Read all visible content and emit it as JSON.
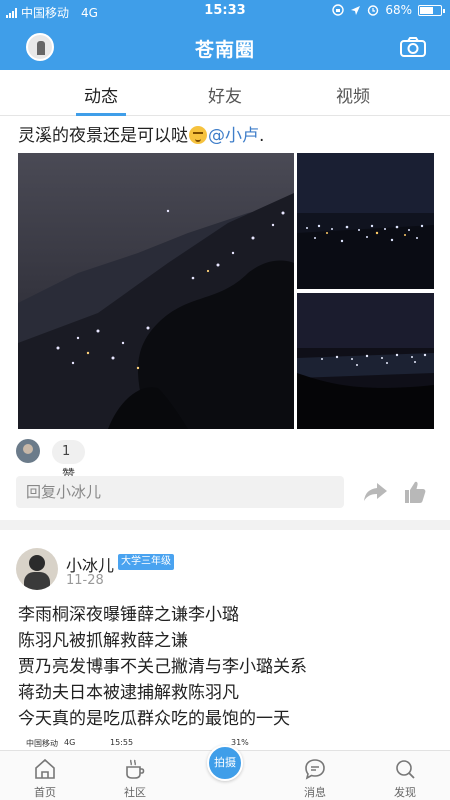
{
  "status": {
    "carrier": "中国移动",
    "network": "4G",
    "time": "15:33",
    "battery": "68%",
    "battery_fraction": 0.68,
    "icons": [
      "rotation-lock-icon",
      "location-icon",
      "alarm-icon"
    ]
  },
  "header": {
    "title": "苍南圈",
    "left_icon": "avatar",
    "right_icon": "camera-icon",
    "accent": "#3f9ee9"
  },
  "tabs": [
    {
      "label": "动态",
      "active": true
    },
    {
      "label": "好友",
      "active": false
    },
    {
      "label": "视频",
      "active": false
    }
  ],
  "post1": {
    "text": "灵溪的夜景还是可以哒",
    "emoji": "smirk-emoji-icon",
    "mention": "@小卢",
    "suffix": ".",
    "photos": 3,
    "likes": "1赞",
    "reply_placeholder": "回复小冰儿"
  },
  "post2": {
    "username": "小冰儿",
    "badge": "大学三年级",
    "date": "11-28",
    "lines": [
      "李雨桐深夜曝锤薛之谦李小璐",
      "陈羽凡被抓解救薛之谦",
      "贾乃亮发博事不关己撇清与李小璐关系",
      "蒋劲夫日本被逮捕解救陈羽凡",
      "今天真的是吃瓜群众吃的最饱的一天"
    ],
    "embedded_status": {
      "carrier": "中国移动",
      "network": "4G",
      "time": "15:55",
      "battery": "31%"
    }
  },
  "bottom_nav": [
    {
      "label": "首页",
      "icon": "home-icon"
    },
    {
      "label": "社区",
      "icon": "coffee-cup-icon"
    },
    {
      "label": "拍摄",
      "icon": "capture-button"
    },
    {
      "label": "消息",
      "icon": "chat-bubble-icon"
    },
    {
      "label": "发现",
      "icon": "search-icon"
    }
  ]
}
